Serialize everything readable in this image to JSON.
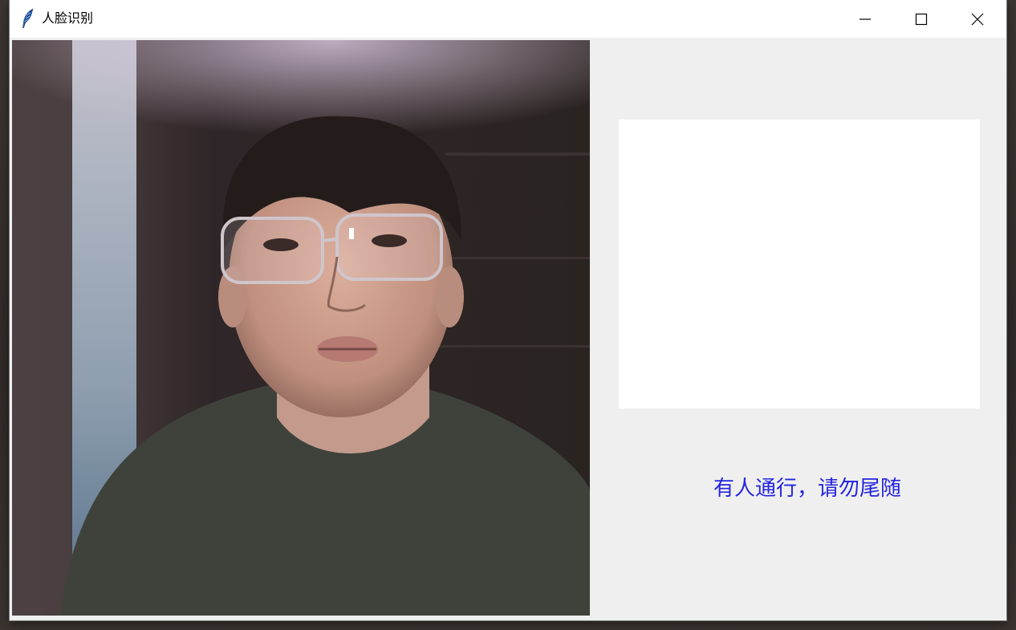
{
  "window": {
    "title": "人脸识别",
    "app_icon": "feather-icon",
    "controls": [
      "minimize-icon",
      "maximize-icon",
      "close-icon"
    ]
  },
  "main": {
    "camera_feed": "camera-feed-image",
    "face_preview": "face-preview-panel",
    "status_message": "有人通行，请勿尾随"
  },
  "colors": {
    "status_text": "#2424e0",
    "panel_background": "#efefef",
    "preview_background": "#ffffff"
  }
}
